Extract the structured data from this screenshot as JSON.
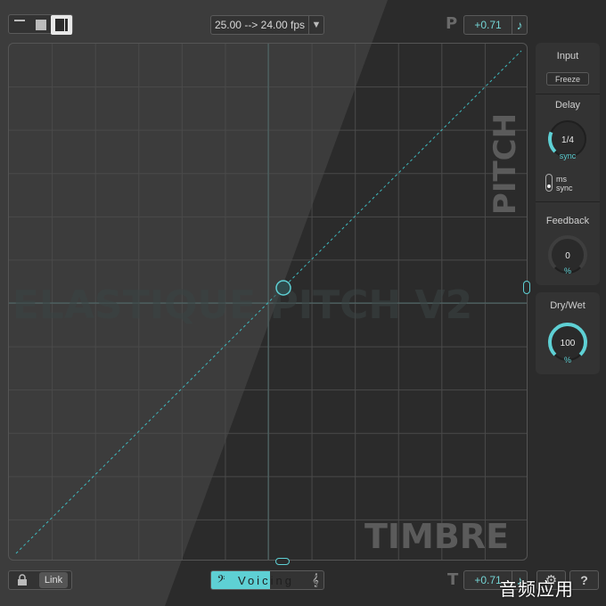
{
  "header": {
    "fps_label": "25.00 --> 24.00 fps",
    "pitch_letter": "P",
    "pitch_value": "+0.71"
  },
  "graph": {
    "title_watermark": "ELASTIQUE PITCH V2",
    "pitch_axis_label": "PITCH",
    "timbre_axis_label": "TIMBRE"
  },
  "side": {
    "input_label": "Input",
    "freeze_label": "Freeze",
    "delay_label": "Delay",
    "delay_value": "1/4",
    "delay_unit": "sync",
    "delay_level": 0.25,
    "mode_ms": "ms",
    "mode_sync": "sync",
    "feedback_label": "Feedback",
    "feedback_value": "0",
    "feedback_unit": "%",
    "feedback_level": 0,
    "drywet_label": "Dry/Wet",
    "drywet_value": "100",
    "drywet_unit": "%",
    "drywet_level": 1
  },
  "footer": {
    "link_label": "Link",
    "voicing_label": "Voicing",
    "timbre_letter": "T",
    "timbre_value": "+0.71"
  },
  "watermark": "音频应用",
  "colors": {
    "accent": "#5ed0d4",
    "bg": "#2b2b2b"
  }
}
